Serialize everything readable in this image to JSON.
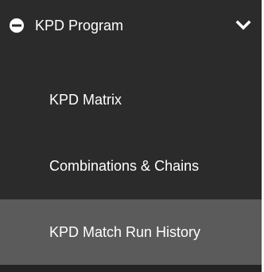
{
  "sidebar": {
    "group": {
      "label": "KPD Program",
      "icon": "minus-circle-icon",
      "chevron_icon": "chevron-down-icon"
    },
    "items": [
      {
        "label": "KPD Matrix"
      },
      {
        "label": "Combinations & Chains"
      },
      {
        "label": "KPD Match Run History",
        "active": true
      }
    ]
  },
  "colors": {
    "panel_bg": "#2b2b2b",
    "active_bg": "#5b5b5b",
    "text": "#ffffff"
  }
}
